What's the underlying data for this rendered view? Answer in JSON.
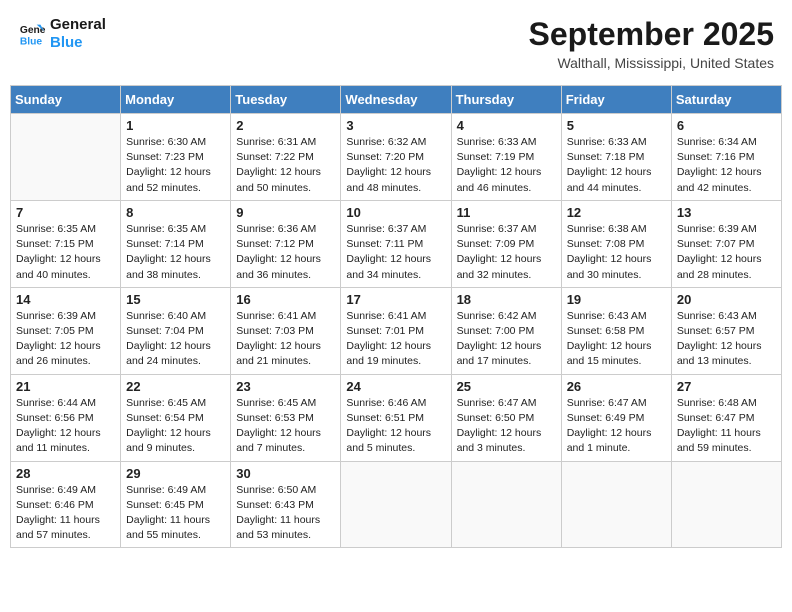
{
  "header": {
    "logo_line1": "General",
    "logo_line2": "Blue",
    "month_title": "September 2025",
    "location": "Walthall, Mississippi, United States"
  },
  "weekdays": [
    "Sunday",
    "Monday",
    "Tuesday",
    "Wednesday",
    "Thursday",
    "Friday",
    "Saturday"
  ],
  "weeks": [
    [
      {
        "day": "",
        "empty": true
      },
      {
        "day": "1",
        "sunrise": "Sunrise: 6:30 AM",
        "sunset": "Sunset: 7:23 PM",
        "daylight": "Daylight: 12 hours and 52 minutes."
      },
      {
        "day": "2",
        "sunrise": "Sunrise: 6:31 AM",
        "sunset": "Sunset: 7:22 PM",
        "daylight": "Daylight: 12 hours and 50 minutes."
      },
      {
        "day": "3",
        "sunrise": "Sunrise: 6:32 AM",
        "sunset": "Sunset: 7:20 PM",
        "daylight": "Daylight: 12 hours and 48 minutes."
      },
      {
        "day": "4",
        "sunrise": "Sunrise: 6:33 AM",
        "sunset": "Sunset: 7:19 PM",
        "daylight": "Daylight: 12 hours and 46 minutes."
      },
      {
        "day": "5",
        "sunrise": "Sunrise: 6:33 AM",
        "sunset": "Sunset: 7:18 PM",
        "daylight": "Daylight: 12 hours and 44 minutes."
      },
      {
        "day": "6",
        "sunrise": "Sunrise: 6:34 AM",
        "sunset": "Sunset: 7:16 PM",
        "daylight": "Daylight: 12 hours and 42 minutes."
      }
    ],
    [
      {
        "day": "7",
        "sunrise": "Sunrise: 6:35 AM",
        "sunset": "Sunset: 7:15 PM",
        "daylight": "Daylight: 12 hours and 40 minutes."
      },
      {
        "day": "8",
        "sunrise": "Sunrise: 6:35 AM",
        "sunset": "Sunset: 7:14 PM",
        "daylight": "Daylight: 12 hours and 38 minutes."
      },
      {
        "day": "9",
        "sunrise": "Sunrise: 6:36 AM",
        "sunset": "Sunset: 7:12 PM",
        "daylight": "Daylight: 12 hours and 36 minutes."
      },
      {
        "day": "10",
        "sunrise": "Sunrise: 6:37 AM",
        "sunset": "Sunset: 7:11 PM",
        "daylight": "Daylight: 12 hours and 34 minutes."
      },
      {
        "day": "11",
        "sunrise": "Sunrise: 6:37 AM",
        "sunset": "Sunset: 7:09 PM",
        "daylight": "Daylight: 12 hours and 32 minutes."
      },
      {
        "day": "12",
        "sunrise": "Sunrise: 6:38 AM",
        "sunset": "Sunset: 7:08 PM",
        "daylight": "Daylight: 12 hours and 30 minutes."
      },
      {
        "day": "13",
        "sunrise": "Sunrise: 6:39 AM",
        "sunset": "Sunset: 7:07 PM",
        "daylight": "Daylight: 12 hours and 28 minutes."
      }
    ],
    [
      {
        "day": "14",
        "sunrise": "Sunrise: 6:39 AM",
        "sunset": "Sunset: 7:05 PM",
        "daylight": "Daylight: 12 hours and 26 minutes."
      },
      {
        "day": "15",
        "sunrise": "Sunrise: 6:40 AM",
        "sunset": "Sunset: 7:04 PM",
        "daylight": "Daylight: 12 hours and 24 minutes."
      },
      {
        "day": "16",
        "sunrise": "Sunrise: 6:41 AM",
        "sunset": "Sunset: 7:03 PM",
        "daylight": "Daylight: 12 hours and 21 minutes."
      },
      {
        "day": "17",
        "sunrise": "Sunrise: 6:41 AM",
        "sunset": "Sunset: 7:01 PM",
        "daylight": "Daylight: 12 hours and 19 minutes."
      },
      {
        "day": "18",
        "sunrise": "Sunrise: 6:42 AM",
        "sunset": "Sunset: 7:00 PM",
        "daylight": "Daylight: 12 hours and 17 minutes."
      },
      {
        "day": "19",
        "sunrise": "Sunrise: 6:43 AM",
        "sunset": "Sunset: 6:58 PM",
        "daylight": "Daylight: 12 hours and 15 minutes."
      },
      {
        "day": "20",
        "sunrise": "Sunrise: 6:43 AM",
        "sunset": "Sunset: 6:57 PM",
        "daylight": "Daylight: 12 hours and 13 minutes."
      }
    ],
    [
      {
        "day": "21",
        "sunrise": "Sunrise: 6:44 AM",
        "sunset": "Sunset: 6:56 PM",
        "daylight": "Daylight: 12 hours and 11 minutes."
      },
      {
        "day": "22",
        "sunrise": "Sunrise: 6:45 AM",
        "sunset": "Sunset: 6:54 PM",
        "daylight": "Daylight: 12 hours and 9 minutes."
      },
      {
        "day": "23",
        "sunrise": "Sunrise: 6:45 AM",
        "sunset": "Sunset: 6:53 PM",
        "daylight": "Daylight: 12 hours and 7 minutes."
      },
      {
        "day": "24",
        "sunrise": "Sunrise: 6:46 AM",
        "sunset": "Sunset: 6:51 PM",
        "daylight": "Daylight: 12 hours and 5 minutes."
      },
      {
        "day": "25",
        "sunrise": "Sunrise: 6:47 AM",
        "sunset": "Sunset: 6:50 PM",
        "daylight": "Daylight: 12 hours and 3 minutes."
      },
      {
        "day": "26",
        "sunrise": "Sunrise: 6:47 AM",
        "sunset": "Sunset: 6:49 PM",
        "daylight": "Daylight: 12 hours and 1 minute."
      },
      {
        "day": "27",
        "sunrise": "Sunrise: 6:48 AM",
        "sunset": "Sunset: 6:47 PM",
        "daylight": "Daylight: 11 hours and 59 minutes."
      }
    ],
    [
      {
        "day": "28",
        "sunrise": "Sunrise: 6:49 AM",
        "sunset": "Sunset: 6:46 PM",
        "daylight": "Daylight: 11 hours and 57 minutes."
      },
      {
        "day": "29",
        "sunrise": "Sunrise: 6:49 AM",
        "sunset": "Sunset: 6:45 PM",
        "daylight": "Daylight: 11 hours and 55 minutes."
      },
      {
        "day": "30",
        "sunrise": "Sunrise: 6:50 AM",
        "sunset": "Sunset: 6:43 PM",
        "daylight": "Daylight: 11 hours and 53 minutes."
      },
      {
        "day": "",
        "empty": true
      },
      {
        "day": "",
        "empty": true
      },
      {
        "day": "",
        "empty": true
      },
      {
        "day": "",
        "empty": true
      }
    ]
  ]
}
